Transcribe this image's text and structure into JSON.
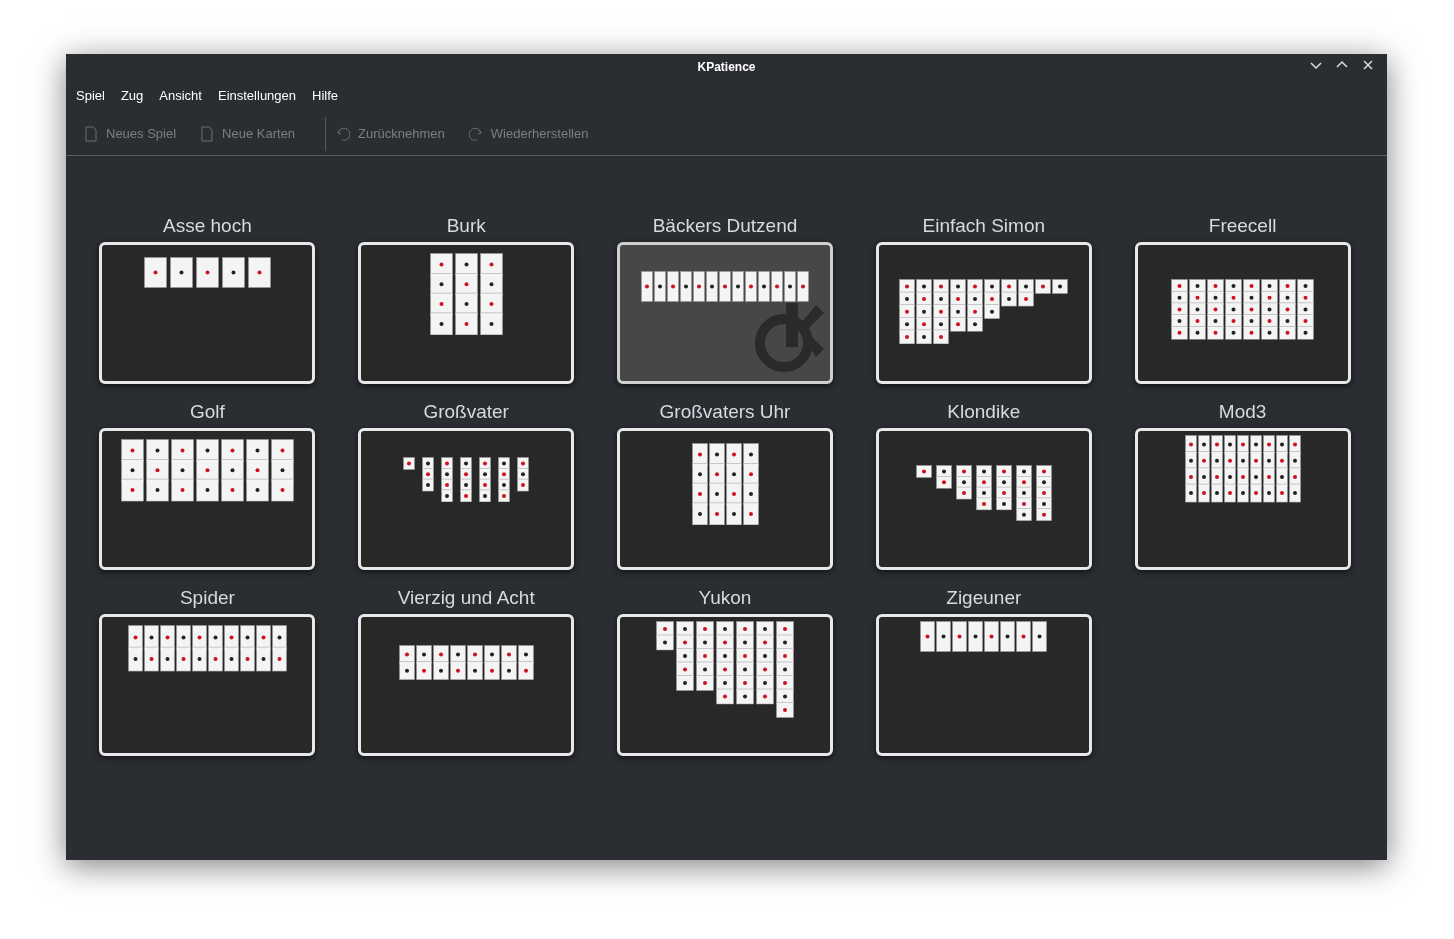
{
  "window": {
    "title": "KPatience"
  },
  "menu": [
    "Spiel",
    "Zug",
    "Ansicht",
    "Einstellungen",
    "Hilfe"
  ],
  "toolbar": [
    {
      "label": "Neues Spiel",
      "kind": "new",
      "disabled": true
    },
    {
      "label": "Neue Karten",
      "kind": "new",
      "disabled": true
    },
    {
      "label": "Zurücknehmen",
      "kind": "undo",
      "disabled": true
    },
    {
      "label": "Wiederherstellen",
      "kind": "redo",
      "disabled": true
    }
  ],
  "games": [
    {
      "name": "Asse hoch",
      "selected": false
    },
    {
      "name": "Burk",
      "selected": false
    },
    {
      "name": "Bäckers Dutzend",
      "selected": true
    },
    {
      "name": "Einfach Simon",
      "selected": false
    },
    {
      "name": "Freecell",
      "selected": false
    },
    {
      "name": "Golf",
      "selected": false
    },
    {
      "name": "Großvater",
      "selected": false
    },
    {
      "name": "Großvaters Uhr",
      "selected": false
    },
    {
      "name": "Klondike",
      "selected": false
    },
    {
      "name": "Mod3",
      "selected": false
    },
    {
      "name": "Spider",
      "selected": false
    },
    {
      "name": "Vierzig und Acht",
      "selected": false
    },
    {
      "name": "Yukon",
      "selected": false
    },
    {
      "name": "Zigeuner",
      "selected": false
    }
  ]
}
